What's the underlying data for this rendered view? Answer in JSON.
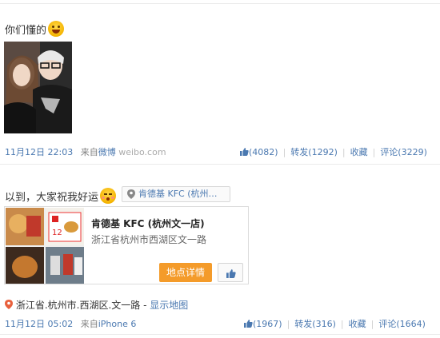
{
  "post1": {
    "text": "你们懂的",
    "time": "11月12日 22:03",
    "source_prefix": "来自",
    "source_name": "微博",
    "source_domain": "weibo.com",
    "likes": "(4082)",
    "repost": "转发(1292)",
    "favorite": "收藏",
    "comment": "评论(3229)"
  },
  "post2": {
    "text": "以到，大家祝我好运",
    "location_tag": "肯德基 KFC (杭州…",
    "card": {
      "title": "肯德基 KFC (杭州文一店)",
      "address": "浙江省杭州市西湖区文一路",
      "detail_button": "地点详情",
      "menu_badge": "12"
    },
    "location_line": "浙江省.杭州市.西湖区.文一路",
    "location_dash": " - ",
    "show_map": "显示地图",
    "time": "11月12日 05:02",
    "source_prefix": "来自",
    "source_name": "iPhone 6",
    "likes": "(1967)",
    "repost": "转发(316)",
    "favorite": "收藏",
    "comment": "评论(1664)"
  },
  "colors": {
    "link": "#4a78b0",
    "meta": "#808080",
    "accent_button": "#f49b2a"
  }
}
